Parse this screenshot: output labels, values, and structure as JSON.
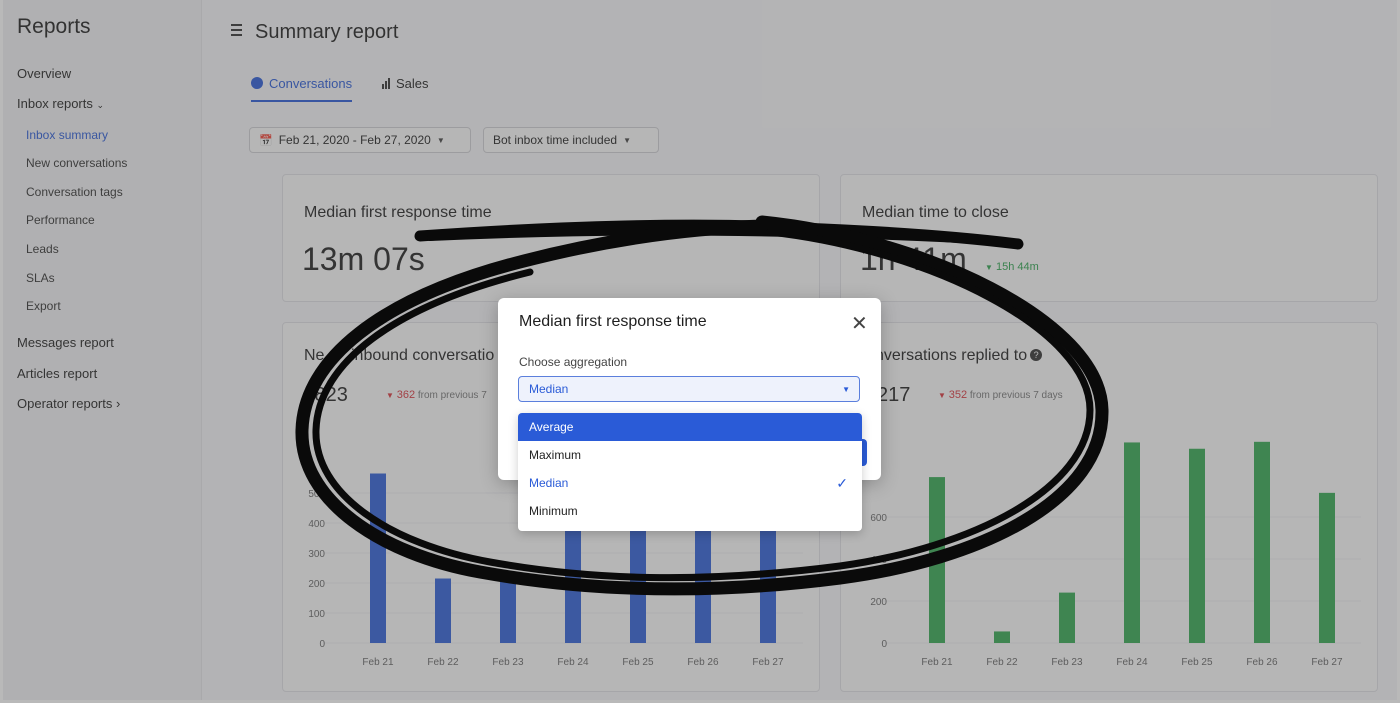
{
  "sidebar": {
    "title": "Reports",
    "items": [
      "Overview",
      "Inbox reports",
      "Messages report",
      "Articles report",
      "Operator reports"
    ],
    "subitems": [
      "Inbox summary",
      "New conversations",
      "Conversation tags",
      "Performance",
      "Leads",
      "SLAs",
      "Export"
    ]
  },
  "header": {
    "title": "Summary report"
  },
  "tabs": [
    {
      "label": "Conversations"
    },
    {
      "label": "Sales"
    }
  ],
  "filters": {
    "date_range": "Feb 21, 2020 - Feb 27, 2020",
    "bot_time": "Bot inbox time included"
  },
  "cards": {
    "first_response": {
      "title": "Median first response time",
      "value": "13m 07s"
    },
    "time_to_close": {
      "title": "Median time to close",
      "value": "1h 41m",
      "delta": "15h 44m"
    },
    "new_inbound": {
      "title_fragment_left": "Ne",
      "title_fragment_right": "inbound conversatio",
      "value_partial": ",823",
      "delta": "362",
      "delta_suffix": "from previous 7"
    },
    "replied_to": {
      "title_partial": "nversations replied to",
      "value_partial": "217",
      "delta": "352",
      "delta_suffix": "from previous 7 days"
    }
  },
  "modal": {
    "title": "Median first response time",
    "label": "Choose aggregation",
    "selected": "Median",
    "options": [
      "Average",
      "Maximum",
      "Median",
      "Minimum"
    ],
    "highlighted_option": "Average"
  },
  "icons": {
    "calendar": "calendar-icon",
    "chat": "chat-bubble-icon",
    "bar": "bar-chart-icon",
    "close": "close-icon",
    "check": "check-icon",
    "help": "help-icon",
    "menu": "hamburger-icon"
  },
  "colors": {
    "accent": "#2a5bd7",
    "bar_blue": "#2f5fd8",
    "bar_green": "#34a853",
    "delta_red": "#d9363e",
    "delta_green": "#2ea44f"
  },
  "chart_data": [
    {
      "type": "bar",
      "categories": [
        "Feb 21",
        "Feb 22",
        "Feb 23",
        "Feb 24",
        "Feb 25",
        "Feb 26",
        "Feb 27"
      ],
      "values": [
        565,
        215,
        225,
        550,
        550,
        550,
        550
      ],
      "yticks": [
        "0",
        "100",
        "200",
        "300",
        "400",
        "500"
      ],
      "ylim": [
        0,
        600
      ],
      "xlabel": "",
      "ylabel": ""
    },
    {
      "type": "bar",
      "categories": [
        "Feb 21",
        "Feb 22",
        "Feb 23",
        "Feb 24",
        "Feb 25",
        "Feb 26",
        "Feb 27"
      ],
      "values": [
        790,
        55,
        240,
        955,
        925,
        958,
        715
      ],
      "yticks": [
        "0",
        "200",
        "400",
        "600"
      ],
      "ylim": [
        0,
        1000
      ],
      "xlabel": "",
      "ylabel": ""
    }
  ]
}
